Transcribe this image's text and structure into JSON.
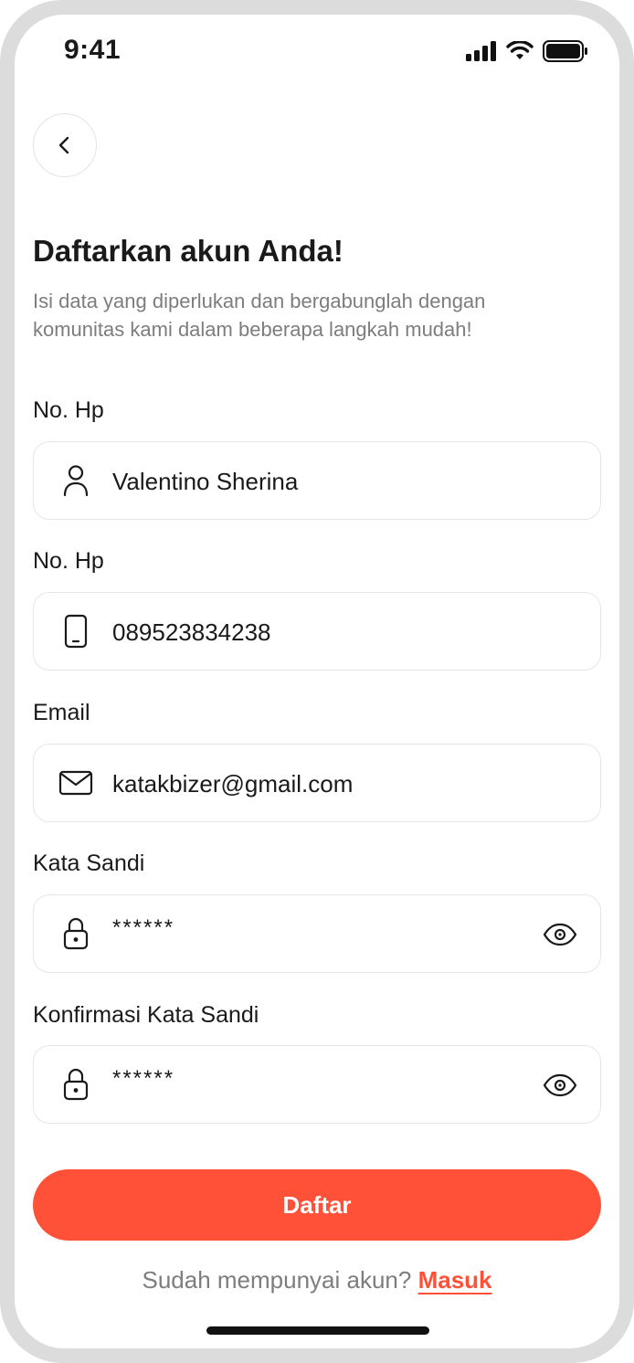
{
  "status_bar": {
    "time": "9:41"
  },
  "header": {
    "title": "Daftarkan akun Anda!",
    "subtitle_line1": "Isi data yang diperlukan dan bergabunglah dengan",
    "subtitle_line2": "komunitas kami dalam beberapa langkah mudah!"
  },
  "form": {
    "name": {
      "label": "No. Hp",
      "value": "Valentino Sherina",
      "icon": "user-icon"
    },
    "phone": {
      "label": "No. Hp",
      "value": "089523834238",
      "icon": "phone-icon"
    },
    "email": {
      "label": "Email",
      "value": "katakbizer@gmail.com",
      "icon": "mail-icon"
    },
    "password": {
      "label": "Kata Sandi",
      "value": "******",
      "icon": "lock-icon"
    },
    "confirm_password": {
      "label": "Konfirmasi Kata Sandi",
      "value": "******",
      "icon": "lock-icon"
    }
  },
  "actions": {
    "submit_label": "Daftar",
    "login_prompt": "Sudah mempunyai akun?",
    "login_link": "Masuk"
  },
  "colors": {
    "accent": "#ff5138",
    "muted_text": "#7d7d7d",
    "border": "#e6e6e6"
  }
}
